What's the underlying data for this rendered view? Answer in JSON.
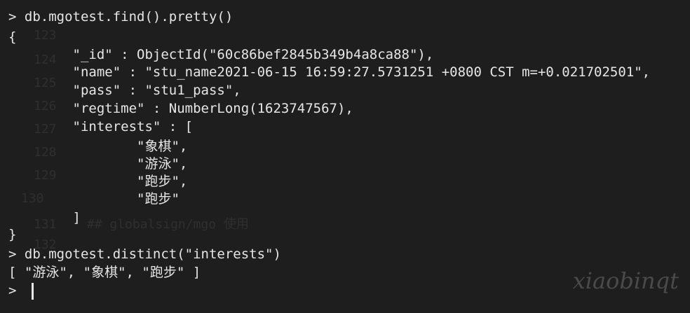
{
  "ghost_lines": [
    {
      "text": "123"
    },
    {
      "text": "124"
    },
    {
      "text": "125"
    },
    {
      "text": "126"
    },
    {
      "text": "127"
    },
    {
      "text": "128"
    },
    {
      "text": "129"
    },
    {
      "text": "130"
    },
    {
      "text": "131    ## globalsign/mgo 使用"
    },
    {
      "text": "132"
    }
  ],
  "lines": [
    {
      "text": "> db.mgotest.find().pretty()"
    },
    {
      "text": "{"
    },
    {
      "text": "        \"_id\" : ObjectId(\"60c86bef2845b349b4a8ca88\"),"
    },
    {
      "text": "        \"name\" : \"stu_name2021-06-15 16:59:27.5731251 +0800 CST m=+0.021702501\","
    },
    {
      "text": "        \"pass\" : \"stu1_pass\","
    },
    {
      "text": "        \"regtime\" : NumberLong(1623747567),"
    },
    {
      "text": "        \"interests\" : ["
    },
    {
      "text": "                \"象棋\","
    },
    {
      "text": "                \"游泳\","
    },
    {
      "text": "                \"跑步\","
    },
    {
      "text": "                \"跑步\""
    },
    {
      "text": "        ]"
    },
    {
      "text": "}"
    },
    {
      "text": "> db.mgotest.distinct(\"interests\")"
    },
    {
      "text": "[ \"游泳\", \"象棋\", \"跑步\" ]"
    },
    {
      "text": "> "
    }
  ],
  "watermark": "xiaobinqt"
}
